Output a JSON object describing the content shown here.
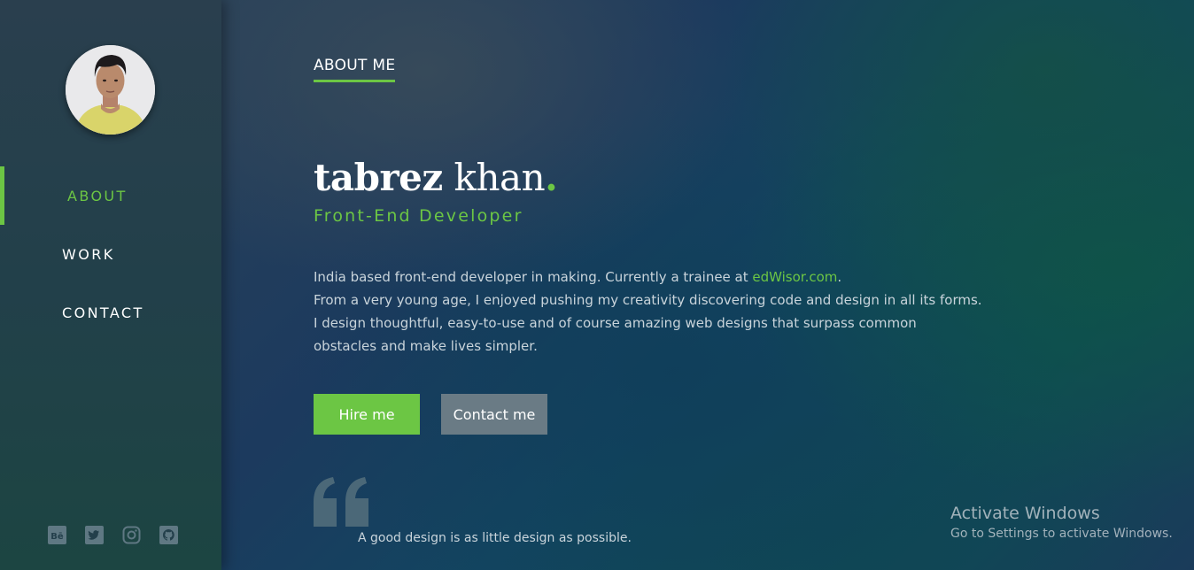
{
  "sidebar": {
    "nav": [
      {
        "label": "ABOUT",
        "active": true
      },
      {
        "label": "WORK",
        "active": false
      },
      {
        "label": "CONTACT",
        "active": false
      }
    ],
    "socials": [
      "behance-icon",
      "twitter-icon",
      "instagram-icon",
      "github-icon"
    ]
  },
  "main": {
    "section_title": "ABOUT ME",
    "name_first": "tabrez",
    "name_last": "khan",
    "name_dot": ".",
    "role": "Front-End Developer",
    "bio": {
      "line1_prefix": "India based front-end developer in making. Currently a trainee at ",
      "line1_link": "edWisor.com",
      "line1_suffix": ".",
      "line2": "From a very young age, I enjoyed pushing my creativity discovering code and design in all its forms.",
      "line3": "I design thoughtful, easy-to-use and of course amazing web designs that surpass common",
      "line4": "obstacles and make lives simpler."
    },
    "buttons": {
      "hire": "Hire me",
      "contact": "Contact me"
    },
    "quote": "A good design is as little design as possible."
  },
  "watermark": {
    "title": "Activate Windows",
    "subtitle": "Go to Settings to activate Windows."
  },
  "colors": {
    "accent": "#6cc644",
    "secondary_button": "#6a7b85",
    "sidebar": "#233f4b"
  }
}
